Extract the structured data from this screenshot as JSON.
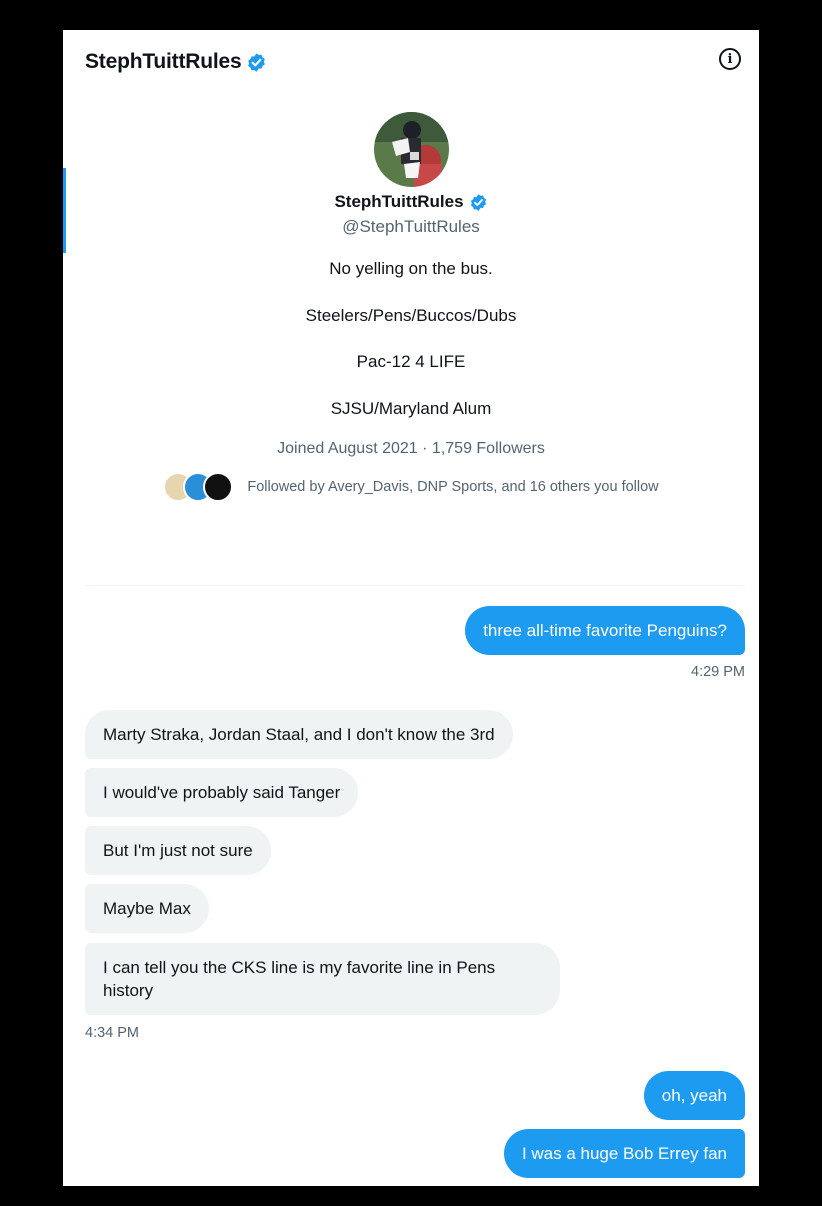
{
  "header": {
    "name": "StephTuittRules"
  },
  "profile": {
    "name": "StephTuittRules",
    "handle": "@StephTuittRules",
    "bio": [
      "No yelling on the bus.",
      "Steelers/Pens/Buccos/Dubs",
      "Pac-12 4 LIFE",
      "SJSU/Maryland Alum"
    ],
    "joined": "Joined August 2021",
    "followers": "1,759 Followers",
    "followed_by": "Followed by Avery_Davis, DNP Sports, and 16 others you follow"
  },
  "messages": {
    "m1": "three all-time favorite Penguins?",
    "t1": "4:29 PM",
    "m2": "Marty Straka, Jordan Staal, and I don't know the 3rd",
    "m3": "I would've probably said Tanger",
    "m4": "But I'm just not sure",
    "m5": "Maybe Max",
    "m6a": "I can tell you the CKS line is my favorite line in Pens",
    "m6b": "history",
    "t2": "4:34 PM",
    "m7": "oh, yeah",
    "m8": "I was a huge Bob Errey fan"
  },
  "colors": {
    "accent": "#1d9bf0",
    "incoming_bubble": "#eff3f4",
    "secondary_text": "#536471"
  },
  "icons": {
    "verified": "verified-badge-icon",
    "info": "info-icon"
  }
}
